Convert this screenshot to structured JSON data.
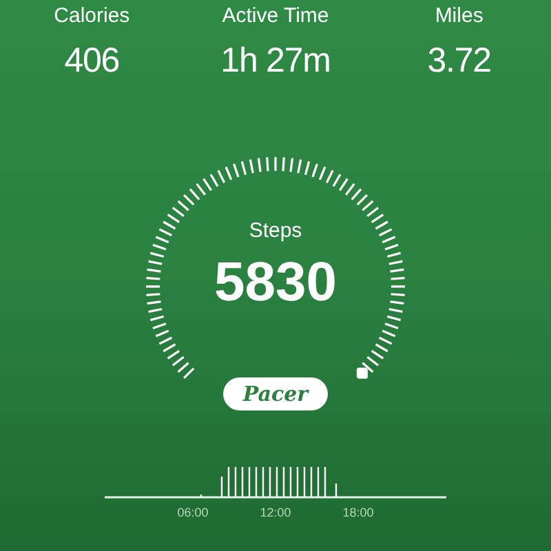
{
  "stats": [
    {
      "label": "Calories",
      "value": "406"
    },
    {
      "label": "Active Time",
      "value": "1h 27m"
    },
    {
      "label": "Miles",
      "value": "3.72"
    }
  ],
  "gauge": {
    "label": "Steps",
    "value": "5830"
  },
  "logo": "Pacer",
  "timeline": {
    "ticks": [
      "06:00",
      "12:00",
      "18:00"
    ]
  }
}
